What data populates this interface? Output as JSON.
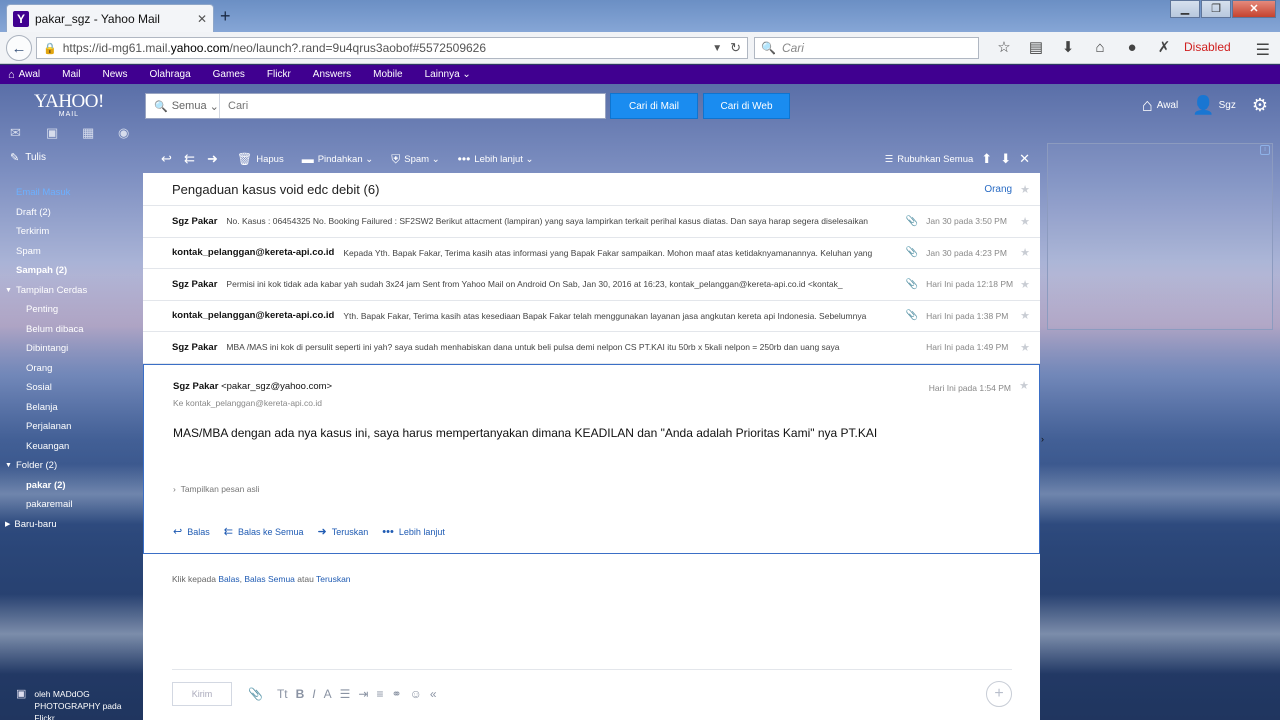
{
  "browser": {
    "tab_title": "pakar_sgz - Yahoo Mail",
    "url_prefix": "https://id-mg61.mail.",
    "url_domain": "yahoo.com",
    "url_suffix": "/neo/launch?.rand=9u4qrus3aobof#5572509626",
    "search_placeholder": "Cari",
    "disabled_label": "Disabled"
  },
  "ynav": {
    "items": [
      "Awal",
      "Mail",
      "News",
      "Olahraga",
      "Games",
      "Flickr",
      "Answers",
      "Mobile",
      "Lainnya"
    ]
  },
  "header": {
    "logo_big": "YAHOO!",
    "logo_small": "MAIL",
    "search_scope": "Semua",
    "search_placeholder": "Cari",
    "btn_mail": "Cari di Mail",
    "btn_web": "Cari di Web",
    "home_label": "Awal",
    "user_label": "Sgz"
  },
  "sidebar": {
    "compose": "Tulis",
    "items": [
      {
        "label": "Email Masuk",
        "style": "active"
      },
      {
        "label": "Draft (2)",
        "style": ""
      },
      {
        "label": "Terkirim",
        "style": ""
      },
      {
        "label": "Spam",
        "style": ""
      },
      {
        "label": "Sampah (2)",
        "style": "bold"
      },
      {
        "label": "Tampilan Cerdas",
        "style": "section"
      },
      {
        "label": "Penting",
        "style": "sub"
      },
      {
        "label": "Belum dibaca",
        "style": "sub"
      },
      {
        "label": "Dibintangi",
        "style": "sub"
      },
      {
        "label": "Orang",
        "style": "sub"
      },
      {
        "label": "Sosial",
        "style": "sub"
      },
      {
        "label": "Belanja",
        "style": "sub"
      },
      {
        "label": "Perjalanan",
        "style": "sub"
      },
      {
        "label": "Keuangan",
        "style": "sub"
      },
      {
        "label": "Folder (2)",
        "style": "section"
      },
      {
        "label": "pakar  (2)",
        "style": "sub bold"
      },
      {
        "label": "pakaremail",
        "style": "sub"
      },
      {
        "label": "Baru-baru",
        "style": "section"
      }
    ],
    "credit_line1": "oleh MADdOG",
    "credit_line2": "PHOTOGRAPHY pada",
    "credit_line3": "Flickr"
  },
  "toolbar": {
    "delete": "Hapus",
    "move": "Pindahkan",
    "spam": "Spam",
    "more": "Lebih lanjut",
    "collapse_all": "Rubuhkan Semua"
  },
  "thread": {
    "subject": "Pengaduan kasus void edc debit (6)",
    "people_link": "Orang",
    "messages": [
      {
        "from": "Sgz Pakar",
        "snippet": "No. Kasus : 06454325 No. Booking Failured : SF2SW2 Berikut attacment (lampiran) yang saya lampirkan terkait perihal kasus diatas. Dan saya harap segera diselesaikan",
        "date": "Jan 30 pada 3:50 PM",
        "attach": true
      },
      {
        "from": "kontak_pelanggan@kereta-api.co.id",
        "snippet": "Kepada Yth. Bapak Fakar, Terima kasih atas informasi yang Bapak Fakar sampaikan. Mohon maaf atas ketidaknyamanannya. Keluhan yang",
        "date": "Jan 30 pada 4:23 PM",
        "attach": true
      },
      {
        "from": "Sgz Pakar",
        "snippet": "Permisi ini kok tidak ada kabar yah sudah 3x24 jam Sent from Yahoo Mail on Android On Sab, Jan 30, 2016 at 16:23, kontak_pelanggan@kereta-api.co.id <kontak_",
        "date": "Hari Ini pada 12:18 PM",
        "attach": true
      },
      {
        "from": "kontak_pelanggan@kereta-api.co.id",
        "snippet": "Yth. Bapak Fakar, Terima kasih atas kesediaan Bapak Fakar telah menggunakan layanan jasa angkutan kereta api Indonesia. Sebelumnya",
        "date": "Hari Ini pada 1:38 PM",
        "attach": true
      },
      {
        "from": "Sgz Pakar",
        "snippet": "MBA /MAS ini kok di persulit seperti ini yah? saya sudah menhabiskan dana untuk beli pulsa demi nelpon CS PT.KAI itu 50rb x 5kali nelpon = 250rb dan uang saya",
        "date": "Hari Ini pada 1:49 PM",
        "attach": false
      }
    ],
    "open": {
      "from_name": "Sgz Pakar",
      "from_email": "<pakar_sgz@yahoo.com>",
      "to": "Ke kontak_pelanggan@kereta-api.co.id",
      "date": "Hari Ini pada 1:54 PM",
      "body": "MAS/MBA dengan ada nya kasus ini, saya harus mempertanyakan dimana KEADILAN dan \"Anda adalah Prioritas Kami\" nya PT.KAI",
      "show_original": "Tampilkan pesan asli",
      "reply": "Balas",
      "reply_all": "Balas ke Semua",
      "forward": "Teruskan",
      "more": "Lebih lanjut"
    },
    "hint_prefix": "Klik kepada",
    "hint_reply": "Balas",
    "hint_sep": ",",
    "hint_reply_all": "Balas Semua",
    "hint_or": "atau",
    "hint_forward": "Teruskan",
    "send_label": "Kirim"
  }
}
